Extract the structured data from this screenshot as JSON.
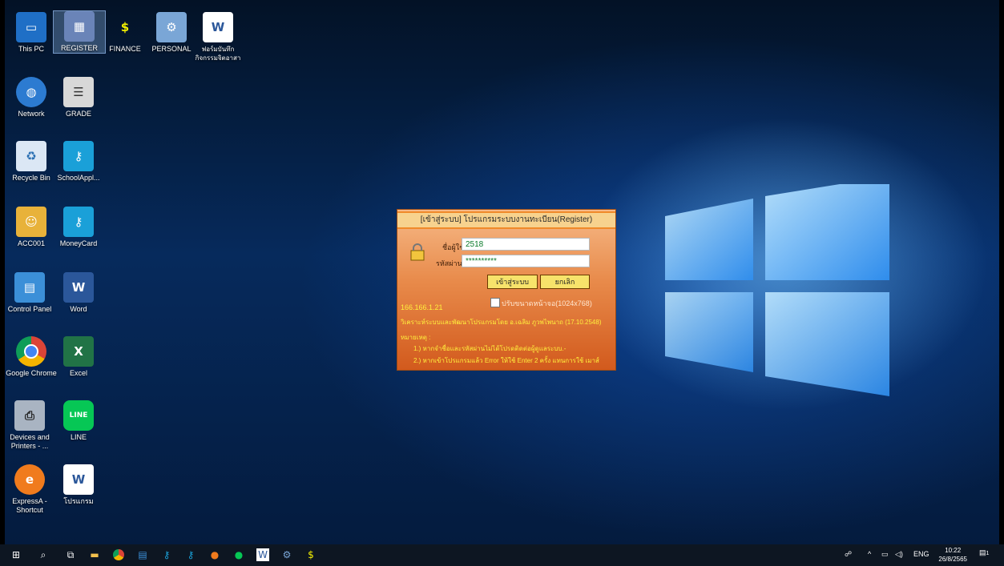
{
  "desktop": {
    "icons": [
      {
        "label": "This PC"
      },
      {
        "label": "REGISTER"
      },
      {
        "label": "FINANCE"
      },
      {
        "label": "PERSONAL"
      },
      {
        "label": "ฟอร์มบันทึก\nกิจกรรมจิตอาสา"
      },
      {
        "label": "Network"
      },
      {
        "label": "GRADE"
      },
      {
        "label": "Recycle Bin"
      },
      {
        "label": "SchoolAppl..."
      },
      {
        "label": "ACC001"
      },
      {
        "label": "MoneyCard"
      },
      {
        "label": "Control Panel"
      },
      {
        "label": "Word"
      },
      {
        "label": "Google Chrome"
      },
      {
        "label": "Excel"
      },
      {
        "label": "Devices and Printers - ..."
      },
      {
        "label": "LINE"
      },
      {
        "label": "ExpressA - Shortcut"
      },
      {
        "label": "โปรแกรม"
      }
    ]
  },
  "login_dialog": {
    "title": "[เข้าสู่ระบบ] โปรแกรมระบบงานทะเบียน(Register)",
    "username_label": "ชื่อผู้ใช้",
    "username_value": "2518",
    "password_label": "รหัสผ่าน",
    "password_value": "**********",
    "login_button": "เข้าสู่ระบบ",
    "cancel_button": "ยกเลิก",
    "resize_checkbox_label": "ปรับขนาดหน้าจอ(1024x768)",
    "ip": "166.166.1.21",
    "developer": "วิเคราะห์ระบบและพัฒนาโปรแกรมโดย อ.เฉลิม ภูวพไพนาถ (17.10.2548)",
    "notes_title": "หมายเหตุ :",
    "note1": "1.) หากจำชื่อและรหัสผ่านไม่ได้โปรดติดต่อผู้ดูแลระบบ.-",
    "note2": "2.) หากเข้าโปรแกรมแล้ว Error ให้ใช้ Enter 2 ครั้ง แทนการใช้ เมาส์"
  },
  "taskbar": {
    "tray_lang": "ENG",
    "time": "10:22",
    "date": "26/8/2565",
    "notification_count": "1"
  }
}
